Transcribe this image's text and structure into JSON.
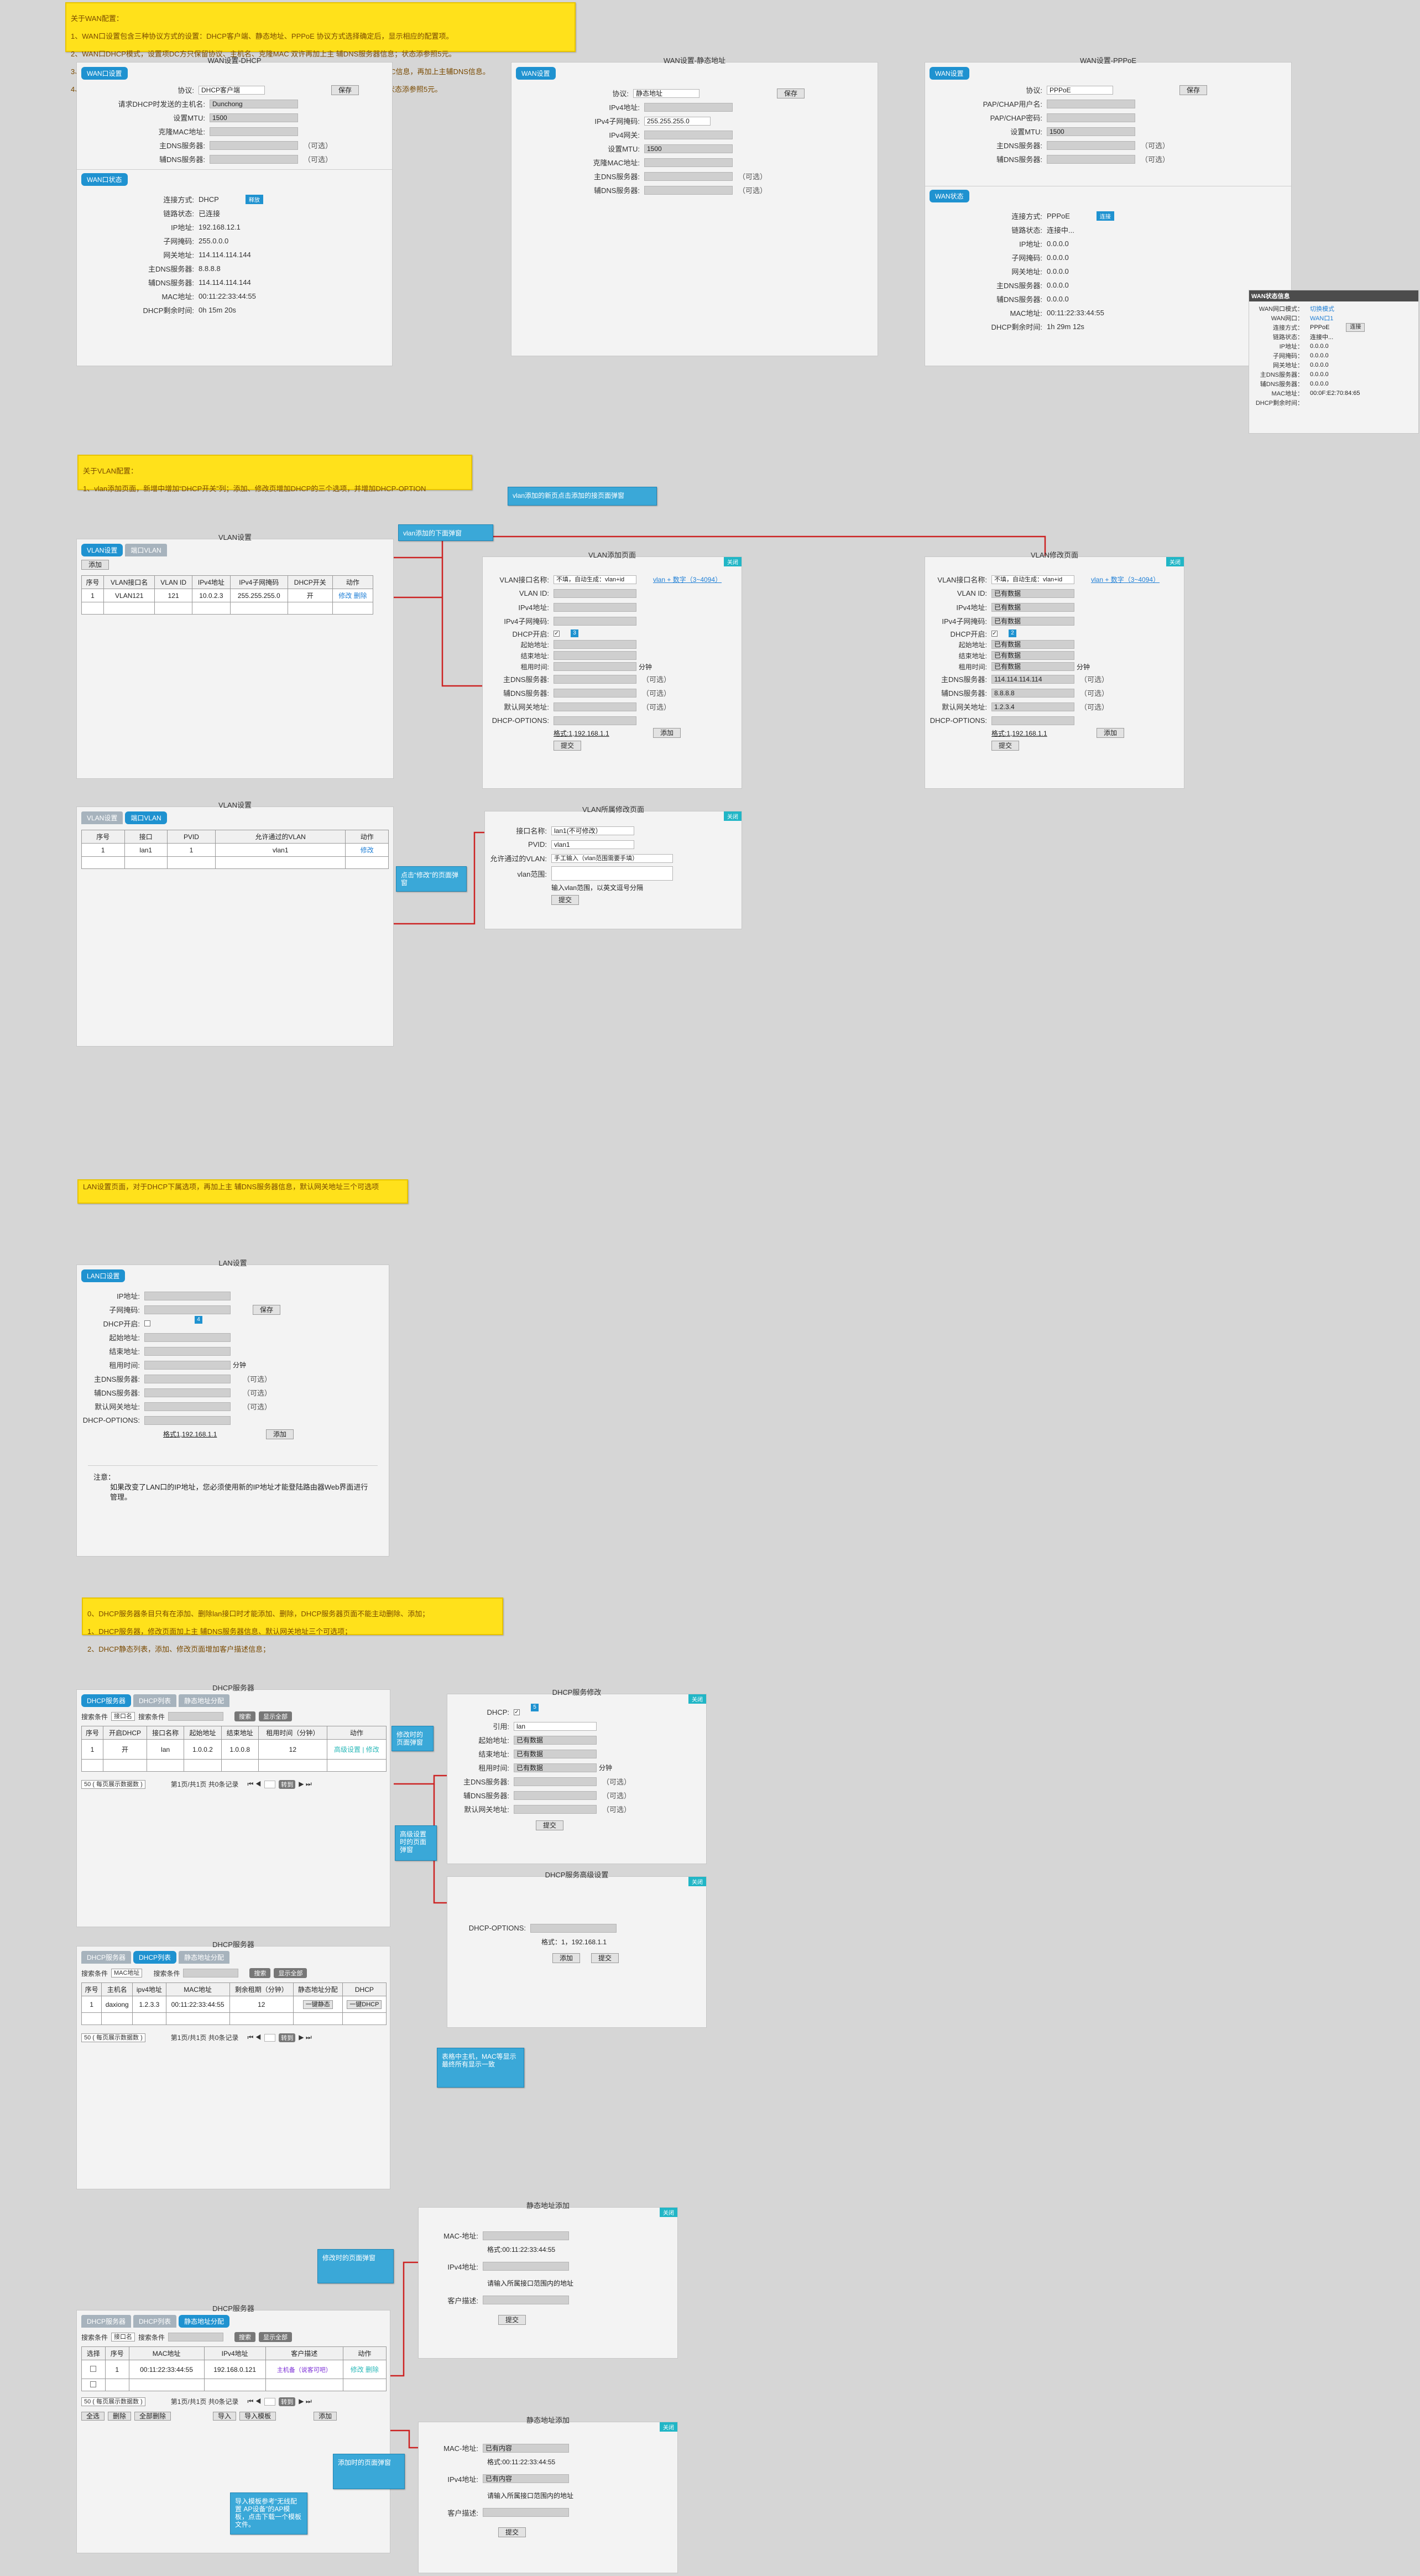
{
  "colors": {
    "note_bg": "#ffe11b",
    "callout_bg": "#3aa8d8",
    "tab_active": "#1f92d0",
    "panel_bg": "#f3f3f3",
    "page_bg": "#d6d6d6",
    "arrow": "#cc2222"
  },
  "wan_note": {
    "title": "关于WAN配置：",
    "lines": [
      "1、WAN口设置包含三种协议方式的设置：DHCP客户端、静态地址、PPPoE 协议方式选择确定后，显示相应的配置项。",
      "2、WAN口DHCP模式，设置项DC方只保留协议、主机名、克隆MAC 双许再加上主 辅DNS服务器信息；状态添参照5元。",
      "3、WAN口设置静态模式，设置项DC方保留协议、IPV4地址、IPV4掩码、IPV4网关、MTU、克隆MAC信息，再加上主辅DNS信息。",
      "4、WAN口PPPoE模式，设置项DC方保留协议、用户名、密码、MTU,再加上主辅DNS服务器信息；状态添参照5元。"
    ]
  },
  "wan_dhcp": {
    "title": "WAN设置-DHCP",
    "tab": "WAN口设置",
    "protocol_label": "协议:",
    "protocol_value": "DHCP客户端",
    "save": "保存",
    "hostname_label": "请求DHCP时发送的主机名:",
    "hostname_value": "Dunchong",
    "mtu_label": "设置MTU:",
    "mtu_value": "1500",
    "clone_mac_label": "克隆MAC地址:",
    "dns1_label": "主DNS服务器:",
    "dns2_label": "辅DNS服务器:",
    "optional": "（可选）",
    "status_tab": "WAN口状态",
    "status": [
      {
        "k": "连接方式:",
        "v": "DHCP"
      },
      {
        "k": "链路状态:",
        "v": "已连接"
      },
      {
        "k": "IP地址:",
        "v": "192.168.12.1"
      },
      {
        "k": "子网掩码:",
        "v": "255.0.0.0"
      },
      {
        "k": "网关地址:",
        "v": "114.114.114.144"
      },
      {
        "k": "主DNS服务器:",
        "v": "8.8.8.8"
      },
      {
        "k": "辅DNS服务器:",
        "v": "114.114.114.144"
      },
      {
        "k": "MAC地址:",
        "v": "00:11:22:33:44:55"
      },
      {
        "k": "DHCP剩余时间:",
        "v": "0h 15m 20s"
      }
    ],
    "release": "释放"
  },
  "wan_static": {
    "title": "WAN设置-静态地址",
    "tab": "WAN设置",
    "protocol_label": "协议:",
    "protocol_value": "静态地址",
    "save": "保存",
    "fields": [
      "IPv4地址:",
      "IPv4子网掩码:",
      "IPv4网关:",
      "设置MTU:",
      "克隆MAC地址:",
      "主DNS服务器:",
      "辅DNS服务器:"
    ],
    "mask_value": "255.255.255.0",
    "mtu_value": "1500",
    "optional": "（可选）"
  },
  "wan_pppoe": {
    "title": "WAN设置-PPPoE",
    "tab": "WAN设置",
    "protocol_label": "协议:",
    "protocol_value": "PPPoE",
    "save": "保存",
    "user_label": "PAP/CHAP用户名:",
    "pass_label": "PAP/CHAP密码:",
    "mtu_label": "设置MTU:",
    "mtu_value": "1500",
    "dns1_label": "主DNS服务器:",
    "dns2_label": "辅DNS服务器:",
    "optional": "（可选）",
    "status_tab": "WAN状态",
    "status": [
      {
        "k": "连接方式:",
        "v": "PPPoE"
      },
      {
        "k": "链路状态:",
        "v": "连接中..."
      },
      {
        "k": "IP地址:",
        "v": "0.0.0.0"
      },
      {
        "k": "子网掩码:",
        "v": "0.0.0.0"
      },
      {
        "k": "网关地址:",
        "v": "0.0.0.0"
      },
      {
        "k": "主DNS服务器:",
        "v": "0.0.0.0"
      },
      {
        "k": "辅DNS服务器:",
        "v": "0.0.0.0"
      },
      {
        "k": "MAC地址:",
        "v": "00:11:22:33:44:55"
      },
      {
        "k": "DHCP剩余时间:",
        "v": "1h 29m 12s"
      }
    ],
    "connect": "连接"
  },
  "wan_info": {
    "title": "WAN状态信息",
    "rows": [
      {
        "k": "WAN网口模式：",
        "v": "切换模式"
      },
      {
        "k": "WAN网口：",
        "v": "WAN口1"
      },
      {
        "k": "连接方式：",
        "v": "PPPoE"
      },
      {
        "k": "链路状态：",
        "v": "连接中..."
      },
      {
        "k": "IP地址：",
        "v": "0.0.0.0"
      },
      {
        "k": "子网掩码：",
        "v": "0.0.0.0"
      },
      {
        "k": "网关地址：",
        "v": "0.0.0.0"
      },
      {
        "k": "主DNS服务器：",
        "v": "0.0.0.0"
      },
      {
        "k": "辅DNS服务器：",
        "v": "0.0.0.0"
      },
      {
        "k": "MAC地址：",
        "v": "00:0F:E2:70:84:65"
      },
      {
        "k": "DHCP剩余时间：",
        "v": ""
      }
    ],
    "connect": "连接"
  },
  "vlan_note": {
    "title": "关于VLAN配置：",
    "lines": [
      "1、vlan添加页面，新增中增加“DHCP开关”列；添加、修改页增加DHCP的三个选项，并增加DHCP-OPTION"
    ]
  },
  "vlan_callout_top": "vlan添加的新页点击添加的接页面弹窗",
  "vlan_callout_add": "vlan添加的下面弹窗",
  "vlan_settings": {
    "title": "VLAN设置",
    "tab1": "VLAN设置",
    "tab2": "端口VLAN",
    "add": "添加",
    "headers": [
      "序号",
      "VLAN接口名",
      "VLAN ID",
      "IPv4地址",
      "IPv4子网掩码",
      "DHCP开关",
      "动作"
    ],
    "rows": [
      [
        "1",
        "VLAN121",
        "121",
        "10.0.2.3",
        "255.255.255.0",
        "开",
        "修改  删除"
      ]
    ]
  },
  "vlan_add": {
    "title": "VLAN添加页面",
    "close": "关闭",
    "name_label": "VLAN接口名称:",
    "name_value": "不填，自动生成：vlan+id",
    "name_hint": "vlan + 数字（3~4094）",
    "id_label": "VLAN ID:",
    "ip_label": "IPv4地址:",
    "mask_label": "IPv4子网掩码:",
    "dhcp_label": "DHCP开启:",
    "start_label": "起始地址:",
    "end_label": "结束地址:",
    "lease_label": "租用时间:",
    "lease_unit": "分钟",
    "dns1_label": "主DNS服务器:",
    "dns2_label": "辅DNS服务器:",
    "gw_label": "默认网关地址:",
    "opt_label": "DHCP-OPTIONS:",
    "optional": "（可选）",
    "format": "格式:1,192.168.1.1",
    "add": "添加",
    "submit": "提交"
  },
  "vlan_edit": {
    "title": "VLAN修改页面",
    "close": "关闭",
    "name_label": "VLAN接口名称:",
    "name_value": "不填，自动生成：vlan+id",
    "name_hint": "vlan + 数字（3~4094）",
    "id_label": "VLAN ID:",
    "id_value": "已有数据",
    "ip_label": "IPv4地址:",
    "ip_value": "已有数据",
    "mask_label": "IPv4子网掩码:",
    "mask_value": "已有数据",
    "dhcp_label": "DHCP开启:",
    "start_label": "起始地址:",
    "start_value": "已有数据",
    "end_label": "结束地址:",
    "end_value": "已有数据",
    "lease_label": "租用时间:",
    "lease_value": "已有数据",
    "lease_unit": "分钟",
    "dns1_label": "主DNS服务器:",
    "dns1_value": "114.114.114.114",
    "dns2_label": "辅DNS服务器:",
    "dns2_value": "8.8.8.8",
    "gw_label": "默认网关地址:",
    "gw_value": "1.2.3.4",
    "opt_label": "DHCP-OPTIONS:",
    "optional": "（可选）",
    "format": "格式:1,192.168.1.1",
    "add": "添加",
    "submit": "提交"
  },
  "port_vlan": {
    "title": "VLAN设置",
    "tab1": "VLAN设置",
    "tab2": "端口VLAN",
    "headers": [
      "序号",
      "接口",
      "PVID",
      "允许通过的VLAN",
      "动作"
    ],
    "rows": [
      [
        "1",
        "lan1",
        "1",
        "vlan1",
        "修改"
      ]
    ]
  },
  "port_callout": "点击“修改”的页面弹窗",
  "port_edit": {
    "title": "VLAN所属修改页面",
    "close": "关闭",
    "name_label": "接口名称:",
    "name_value": "lan1(不可修改）",
    "pvid_label": "PVID:",
    "pvid_value": "vlan1",
    "allow_label": "允许通过的VLAN:",
    "allow_value": "手工输入（vlan范围需要手填）",
    "range_label": "vlan范围:",
    "range_hint": "输入vlan范围，以英文逗号分隔",
    "submit": "提交"
  },
  "lan_note": "LAN设置页面，对于DHCP下属选项，再加上主 辅DNS服务器信息，默认网关地址三个可选项",
  "lan": {
    "title": "LAN设置",
    "tab": "LAN口设置",
    "ip_label": "IP地址:",
    "mask_label": "子网掩码:",
    "dhcp_label": "DHCP开启:",
    "start_label": "起始地址:",
    "end_label": "结束地址:",
    "lease_label": "租用时间:",
    "lease_unit": "分钟",
    "dns1_label": "主DNS服务器:",
    "dns2_label": "辅DNS服务器:",
    "gw_label": "默认网关地址:",
    "opt_label": "DHCP-OPTIONS:",
    "optional": "（可选）",
    "format": "格式1,192.168.1.1",
    "add": "添加",
    "save": "保存",
    "note_title": "注意：",
    "note_text": "如果改变了LAN口的IP地址，您必须使用新的IP地址才能登陆路由器Web界面进行管理。"
  },
  "dhcp_note": {
    "lines": [
      "0、DHCP服务器条目只有在添加、删除lan接口时才能添加、删除，DHCP服务器页面不能主动删除、添加；",
      "1、DHCP服务器，修改页面加上主 辅DNS服务器信息、默认网关地址三个可选项；",
      "2、DHCP静态列表，添加、修改页面增加客户描述信息；"
    ]
  },
  "dhcp_server": {
    "title": "DHCP服务器",
    "tab1": "DHCP服务器",
    "tab2": "DHCP列表",
    "tab3": "静态地址分配",
    "search_label": "搜索条件",
    "search_select": "接口名",
    "search_value_label": "搜索条件",
    "search_btn": "搜索",
    "show_all": "显示全部",
    "headers": [
      "序号",
      "开启DHCP",
      "接口名称",
      "起始地址",
      "结束地址",
      "租用时间（分钟）",
      "动作"
    ],
    "rows": [
      [
        "1",
        "开",
        "lan",
        "1.0.0.2",
        "1.0.0.8",
        "12",
        "高级设置 | 修改"
      ]
    ],
    "page_size": "50 ( 每页展示数据数 )",
    "page_info": "第1页/共1页 共0条记录",
    "go": "转到"
  },
  "dhcp_callout1": "修改时的页面弹窗",
  "dhcp_callout2": "高级设置时的页面弹窗",
  "dhcp_edit": {
    "title": "DHCP服务修改",
    "close": "关闭",
    "dhcp_label": "DHCP:",
    "ref_label": "引用:",
    "ref_value": "lan",
    "start_label": "起始地址:",
    "start_value": "已有数据",
    "end_label": "结束地址:",
    "end_value": "已有数据",
    "lease_label": "租用时间:",
    "lease_value": "已有数据",
    "lease_unit": "分钟",
    "dns1_label": "主DNS服务器:",
    "dns2_label": "辅DNS服务器:",
    "gw_label": "默认网关地址:",
    "optional": "（可选）",
    "submit": "提交"
  },
  "dhcp_adv": {
    "title": "DHCP服务高级设置",
    "close": "关闭",
    "opt_label": "DHCP-OPTIONS:",
    "format": "格式：1，192.168.1.1",
    "add": "添加",
    "submit": "提交"
  },
  "dhcp_list": {
    "title": "DHCP服务器",
    "tab1": "DHCP服务器",
    "tab2": "DHCP列表",
    "tab3": "静态地址分配",
    "search_label": "搜索条件",
    "search_select": "MAC地址",
    "search_value_label": "搜索条件",
    "search_btn": "搜索",
    "show_all": "显示全部",
    "headers": [
      "序号",
      "主机名",
      "ipv4地址",
      "MAC地址",
      "剩余租期（分钟）",
      "静态地址分配",
      "DHCP"
    ],
    "rows": [
      [
        "1",
        "daxiong",
        "1.2.3.3",
        "00:11:22:33:44:55",
        "12",
        "一键静态",
        "一键DHCP"
      ]
    ],
    "page_size": "50 ( 每页展示数据数 )",
    "page_info": "第1页/共1页 共0条记录",
    "go": "转到"
  },
  "list_callout": "表格中主机，MAC等显示最终所有显示一致",
  "static_callout_top": "修改时的页面弹窗",
  "static_add": {
    "title": "静态地址添加",
    "close": "关闭",
    "mac_label": "MAC-地址:",
    "mac_hint": "格式:00:11:22:33:44:55",
    "ip_label": "IPv4地址:",
    "ip_hint": "请输入所属接口范围内的地址",
    "desc_label": "客户描述:",
    "submit": "提交"
  },
  "static_list": {
    "title": "DHCP服务器",
    "tab1": "DHCP服务器",
    "tab2": "DHCP列表",
    "tab3": "静态地址分配",
    "search_label": "搜索条件",
    "search_select": "接口名",
    "search_value_label": "搜索条件",
    "search_btn": "搜索",
    "show_all": "显示全部",
    "headers": [
      "选择",
      "序号",
      "MAC地址",
      "IPv4地址",
      "客户描述",
      "动作"
    ],
    "rows": [
      [
        "",
        "1",
        "00:11:22:33:44:55",
        "192.168.0.121",
        "主机备（说客可吧）",
        "修改  删除"
      ],
      [
        "",
        "",
        "",
        "",
        "",
        ""
      ]
    ],
    "page_size": "50 ( 每页展示数据数 )",
    "page_info": "第1页/共1页 共0条记录",
    "go": "转到",
    "btn_all": "全选",
    "btn_del": "删除",
    "btn_delall": "全部删除",
    "btn_import": "导入",
    "btn_template": "导入模板",
    "btn_add": "添加"
  },
  "static_callout_add": "添加时的页面弹窗",
  "static_callout_import": "导入模板参考“无线配置 AP设备”的AP模板，点击下载一个模板文件。",
  "static_edit": {
    "title": "静态地址添加",
    "close": "关闭",
    "mac_label": "MAC-地址:",
    "mac_value": "已有内容",
    "mac_hint": "格式:00:11:22:33:44:55",
    "ip_label": "IPv4地址:",
    "ip_value": "已有内容",
    "ip_hint": "请输入所属接口范围内的地址",
    "desc_label": "客户描述:",
    "submit": "提交"
  }
}
